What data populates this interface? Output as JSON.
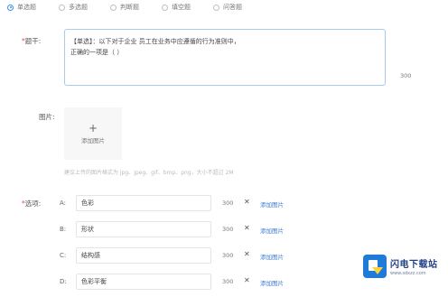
{
  "question_types": [
    {
      "label": "单选题",
      "selected": true
    },
    {
      "label": "多选题",
      "selected": false
    },
    {
      "label": "判断题",
      "selected": false
    },
    {
      "label": "填空题",
      "selected": false
    },
    {
      "label": "问答题",
      "selected": false
    }
  ],
  "stem": {
    "required_mark": "*",
    "label": "题干:",
    "value": "【单选】：以下对于企业 员工在业务中应遵循的行为准则中，\n正确的一项是（ ）",
    "count": "300"
  },
  "image": {
    "label": "图片:",
    "add_plus": "+",
    "add_label": "添加图片",
    "tip": "建议上传的图片格式为 jpg、jpeg、gif、bmp、png，大小不超过 2M"
  },
  "options": {
    "required_mark": "*",
    "label": "选项:",
    "delete_glyph": "✕",
    "add_image_label": "添加图片",
    "items": [
      {
        "letter": "A:",
        "value": "色彩",
        "count": "300"
      },
      {
        "letter": "B:",
        "value": "形状",
        "count": "300"
      },
      {
        "letter": "C:",
        "value": "结构感",
        "count": "300"
      },
      {
        "letter": "D:",
        "value": "色彩平衡",
        "count": "300"
      }
    ]
  },
  "watermark": {
    "title": "闪电下载站",
    "url": "www.sdxzz.com"
  },
  "colors": {
    "accent": "#3a8ee6",
    "link": "#3a7bd5",
    "required": "#e84a4a"
  }
}
